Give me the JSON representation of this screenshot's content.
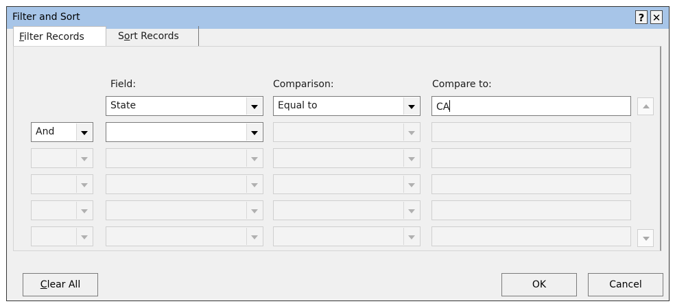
{
  "window": {
    "title": "Filter and Sort",
    "help_label": "?",
    "close_label": "✕"
  },
  "tabs": [
    {
      "label": "Filter Records",
      "mnemonic": "F",
      "rest": "ilter Records"
    },
    {
      "label": "Sort Records",
      "pre": "S",
      "mnemonic": "o",
      "rest": "rt Records"
    }
  ],
  "columns": {
    "field": "Field:",
    "comparison": "Comparison:",
    "compare_to": "Compare to:"
  },
  "rows": [
    {
      "connector": "",
      "field": "State",
      "comparison": "Equal to",
      "value": "CA"
    },
    {
      "connector": "And",
      "field": "",
      "comparison": "",
      "value": ""
    },
    {
      "connector": "",
      "field": "",
      "comparison": "",
      "value": ""
    },
    {
      "connector": "",
      "field": "",
      "comparison": "",
      "value": ""
    },
    {
      "connector": "",
      "field": "",
      "comparison": "",
      "value": ""
    },
    {
      "connector": "",
      "field": "",
      "comparison": "",
      "value": ""
    }
  ],
  "buttons": {
    "clear_all": {
      "label": "Clear All",
      "mnemonic": "C",
      "rest": "lear All"
    },
    "ok": "OK",
    "cancel": "Cancel"
  },
  "icons": {
    "help": "help-icon",
    "close": "close-icon",
    "dropdown": "chevron-down-icon",
    "scroll_up": "scroll-up-icon",
    "scroll_down": "scroll-down-icon"
  }
}
